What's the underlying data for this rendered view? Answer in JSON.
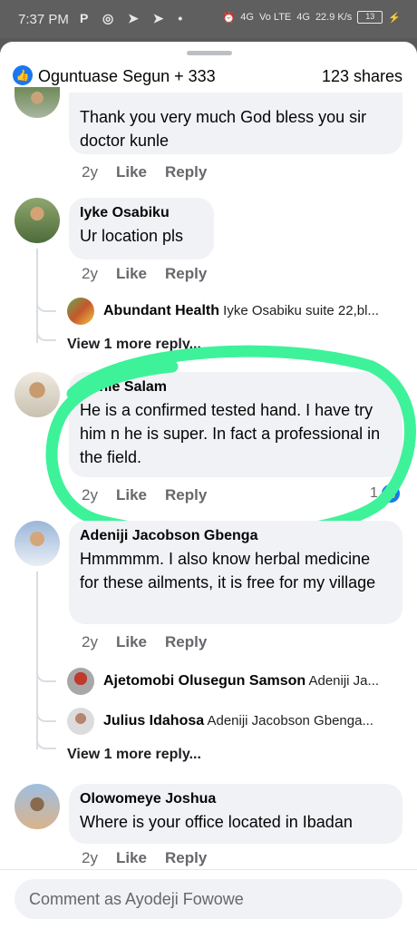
{
  "status_bar": {
    "time": "7:37 PM",
    "left_icons": "P ◎ ➤ ➤ •",
    "right_icons": [
      "⏰",
      "4G",
      "Vo LTE",
      "4G",
      "22.9 K/s"
    ],
    "battery": "13",
    "charging_icon": "⚡"
  },
  "header": {
    "reactors": "Oguntuase Segun + 333",
    "shares": "123 shares",
    "like_icon": "👍"
  },
  "comments": [
    {
      "text": "Thank you very much God bless you sir doctor kunle",
      "time": "2y",
      "like": "Like",
      "reply": "Reply"
    },
    {
      "author": "Iyke Osabiku",
      "text": "Ur location pls",
      "time": "2y",
      "like": "Like",
      "reply": "Reply",
      "replies": [
        {
          "author": "Abundant Health",
          "text": "Iyke Osabiku suite 22,bl..."
        }
      ],
      "view_more": "View 1 more reply..."
    },
    {
      "author": "Kunle Salam",
      "text": "He is a confirmed tested hand. I have try him n he is super. In fact a professional in the field.",
      "time": "2y",
      "like": "Like",
      "reply": "Reply",
      "reaction_count": "1"
    },
    {
      "author": "Adeniji Jacobson Gbenga",
      "text": "Hmmmmm. I also know herbal medicine for these ailments, it is free for my village",
      "time": "2y",
      "like": "Like",
      "reply": "Reply",
      "replies": [
        {
          "author": "Ajetomobi Olusegun Samson",
          "text": "Adeniji Ja..."
        },
        {
          "author": "Julius Idahosa",
          "text": "Adeniji Jacobson Gbenga..."
        }
      ],
      "view_more": "View 1 more reply..."
    },
    {
      "author": "Olowomeye Joshua",
      "text": "Where is your office located in Ibadan",
      "time": "2y",
      "like": "Like",
      "reply": "Reply"
    }
  ],
  "composer": {
    "placeholder": "Comment as Ayodeji Fowowe"
  },
  "colors": {
    "accent": "#1877f2",
    "highlight_marker": "#3ef29a",
    "bubble": "#f0f2f5"
  }
}
